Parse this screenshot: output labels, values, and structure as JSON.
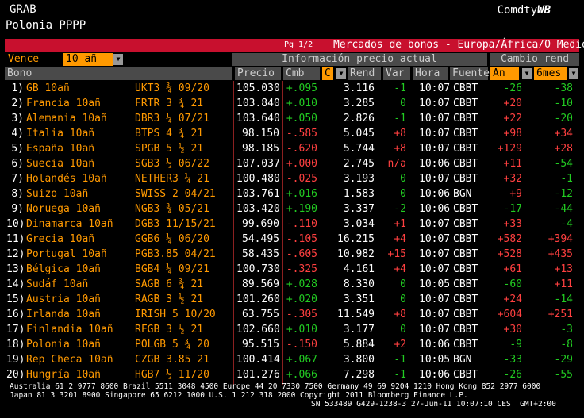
{
  "header": {
    "line1": "GRAB",
    "line2": "Polonia PPPP",
    "brand_text": "Comdty",
    "brand_bold": "WB"
  },
  "titlebar": {
    "page": "Pg 1/2",
    "title": "Mercados de bonos - Europa/África/O Medio"
  },
  "filter": {
    "label": "Vence",
    "value": "10 añ"
  },
  "groups": {
    "info": "Información precio actual",
    "cambio": "Cambio rend"
  },
  "columns": {
    "bono": "Bono",
    "precio": "Precio",
    "cmb": "Cmb",
    "c": "C",
    "rend": "Rend",
    "var": "Var",
    "hora": "Hora",
    "fuente": "Fuente",
    "an": "An",
    "seis": "6mes"
  },
  "rows": [
    {
      "n": "1)",
      "name": "GB 10añ",
      "tk": "UKT3 ¾ 09/20",
      "precio": "105.030",
      "cmb": "+.095",
      "cs": "gr",
      "rend": "3.116",
      "var": "-1",
      "vs": "gr",
      "hora": "10:07",
      "src": "CBBT",
      "an": "-26",
      "as": "gr",
      "m6": "-38",
      "ms": "gr"
    },
    {
      "n": "2)",
      "name": "Francia 10añ",
      "tk": "FRTR 3 ¾ 21",
      "precio": "103.840",
      "cmb": "+.010",
      "cs": "gr",
      "rend": "3.285",
      "var": "0",
      "vs": "gr",
      "hora": "10:07",
      "src": "CBBT",
      "an": "+20",
      "as": "rd",
      "m6": "-10",
      "ms": "gr"
    },
    {
      "n": "3)",
      "name": "Alemania 10añ",
      "tk": "DBR3 ¼ 07/21",
      "precio": "103.640",
      "cmb": "+.050",
      "cs": "gr",
      "rend": "2.826",
      "var": "-1",
      "vs": "gr",
      "hora": "10:07",
      "src": "CBBT",
      "an": "+22",
      "as": "rd",
      "m6": "-20",
      "ms": "gr"
    },
    {
      "n": "4)",
      "name": "Italia 10añ",
      "tk": "BTPS 4 ¾ 21",
      "precio": "98.150",
      "cmb": "-.585",
      "cs": "rd",
      "rend": "5.045",
      "var": "+8",
      "vs": "rd",
      "hora": "10:07",
      "src": "CBBT",
      "an": "+98",
      "as": "rd",
      "m6": "+34",
      "ms": "rd"
    },
    {
      "n": "5)",
      "name": "España 10añ",
      "tk": "SPGB 5 ½ 21",
      "precio": "98.185",
      "cmb": "-.620",
      "cs": "rd",
      "rend": "5.744",
      "var": "+8",
      "vs": "rd",
      "hora": "10:07",
      "src": "CBBT",
      "an": "+129",
      "as": "rd",
      "m6": "+28",
      "ms": "rd"
    },
    {
      "n": "6)",
      "name": "Suecia 10añ",
      "tk": "SGB3 ½ 06/22",
      "precio": "107.037",
      "cmb": "+.000",
      "cs": "rd",
      "rend": "2.745",
      "var": "n/a",
      "vs": "rd",
      "hora": "10:06",
      "src": "CBBT",
      "an": "+11",
      "as": "rd",
      "m6": "-54",
      "ms": "gr"
    },
    {
      "n": "7)",
      "name": "Holandés 10añ",
      "tk": "NETHER3 ¼ 21",
      "precio": "100.480",
      "cmb": "-.025",
      "cs": "rd",
      "rend": "3.193",
      "var": "0",
      "vs": "gr",
      "hora": "10:07",
      "src": "CBBT",
      "an": "+32",
      "as": "rd",
      "m6": "-1",
      "ms": "gr"
    },
    {
      "n": "8)",
      "name": "Suizo 10añ",
      "tk": "SWISS 2 04/21",
      "precio": "103.761",
      "cmb": "+.016",
      "cs": "gr",
      "rend": "1.583",
      "var": "0",
      "vs": "gr",
      "hora": "10:06",
      "src": "BGN",
      "an": "+9",
      "as": "rd",
      "m6": "-12",
      "ms": "gr"
    },
    {
      "n": "9)",
      "name": "Noruega 10añ",
      "tk": "NGB3 ¾ 05/21",
      "precio": "103.420",
      "cmb": "+.190",
      "cs": "gr",
      "rend": "3.337",
      "var": "-2",
      "vs": "gr",
      "hora": "10:06",
      "src": "CBBT",
      "an": "-17",
      "as": "gr",
      "m6": "-44",
      "ms": "gr"
    },
    {
      "n": "10)",
      "name": "Dinamarca 10añ",
      "tk": "DGB3 11/15/21",
      "precio": "99.690",
      "cmb": "-.110",
      "cs": "rd",
      "rend": "3.034",
      "var": "+1",
      "vs": "rd",
      "hora": "10:07",
      "src": "CBBT",
      "an": "+33",
      "as": "rd",
      "m6": "-4",
      "ms": "gr"
    },
    {
      "n": "11)",
      "name": "Grecia 10añ",
      "tk": "GGB6 ¼ 06/20",
      "precio": "54.495",
      "cmb": "-.105",
      "cs": "rd",
      "rend": "16.215",
      "var": "+4",
      "vs": "rd",
      "hora": "10:07",
      "src": "CBBT",
      "an": "+582",
      "as": "rd",
      "m6": "+394",
      "ms": "rd"
    },
    {
      "n": "12)",
      "name": "Portugal 10añ",
      "tk": "PGB3.85 04/21",
      "precio": "58.435",
      "cmb": "-.605",
      "cs": "rd",
      "rend": "10.982",
      "var": "+15",
      "vs": "rd",
      "hora": "10:07",
      "src": "CBBT",
      "an": "+528",
      "as": "rd",
      "m6": "+435",
      "ms": "rd"
    },
    {
      "n": "13)",
      "name": "Bélgica 10añ",
      "tk": "BGB4 ¼ 09/21",
      "precio": "100.730",
      "cmb": "-.325",
      "cs": "rd",
      "rend": "4.161",
      "var": "+4",
      "vs": "rd",
      "hora": "10:07",
      "src": "CBBT",
      "an": "+61",
      "as": "rd",
      "m6": "+13",
      "ms": "rd"
    },
    {
      "n": "14)",
      "name": "Sudáf 10añ",
      "tk": "SAGB 6 ¾ 21",
      "precio": "89.569",
      "cmb": "+.028",
      "cs": "gr",
      "rend": "8.330",
      "var": "0",
      "vs": "gr",
      "hora": "10:05",
      "src": "CBBT",
      "an": "-60",
      "as": "gr",
      "m6": "+11",
      "ms": "rd"
    },
    {
      "n": "15)",
      "name": "Austria 10añ",
      "tk": "RAGB 3 ½ 21",
      "precio": "101.260",
      "cmb": "+.020",
      "cs": "gr",
      "rend": "3.351",
      "var": "0",
      "vs": "gr",
      "hora": "10:07",
      "src": "CBBT",
      "an": "+24",
      "as": "rd",
      "m6": "-14",
      "ms": "gr"
    },
    {
      "n": "16)",
      "name": "Irlanda 10añ",
      "tk": "IRISH 5 10/20",
      "precio": "63.755",
      "cmb": "-.305",
      "cs": "rd",
      "rend": "11.549",
      "var": "+8",
      "vs": "rd",
      "hora": "10:07",
      "src": "CBBT",
      "an": "+604",
      "as": "rd",
      "m6": "+251",
      "ms": "rd"
    },
    {
      "n": "17)",
      "name": "Finlandia 10añ",
      "tk": "RFGB 3 ½ 21",
      "precio": "102.660",
      "cmb": "+.010",
      "cs": "gr",
      "rend": "3.177",
      "var": "0",
      "vs": "gr",
      "hora": "10:07",
      "src": "CBBT",
      "an": "+30",
      "as": "rd",
      "m6": "-3",
      "ms": "gr"
    },
    {
      "n": "18)",
      "name": "Polonia 10añ",
      "tk": "POLGB 5 ¾ 20",
      "precio": "95.515",
      "cmb": "-.150",
      "cs": "rd",
      "rend": "5.884",
      "var": "+2",
      "vs": "rd",
      "hora": "10:06",
      "src": "CBBT",
      "an": "-9",
      "as": "gr",
      "m6": "-8",
      "ms": "gr"
    },
    {
      "n": "19)",
      "name": "Rep Checa 10añ",
      "tk": "CZGB 3.85 21",
      "precio": "100.414",
      "cmb": "+.067",
      "cs": "gr",
      "rend": "3.800",
      "var": "-1",
      "vs": "gr",
      "hora": "10:05",
      "src": "BGN",
      "an": "-33",
      "as": "gr",
      "m6": "-29",
      "ms": "gr"
    },
    {
      "n": "20)",
      "name": "Hungría 10añ",
      "tk": "HGB7 ½ 11/20",
      "precio": "101.276",
      "cmb": "+.066",
      "cs": "gr",
      "rend": "7.298",
      "var": "-1",
      "vs": "gr",
      "hora": "10:06",
      "src": "CBBT",
      "an": "-26",
      "as": "gr",
      "m6": "-55",
      "ms": "gr"
    }
  ],
  "footer": {
    "l1": "Australia 61 2 9777 8600 Brazil 5511 3048 4500 Europe 44 20 7330 7500 Germany 49 69 9204 1210 Hong Kong 852 2977 6000",
    "l2": "Japan 81 3 3201 8900       Singapore 65 6212 1000       U.S. 1 212 318 2000       Copyright 2011 Bloomberg Finance L.P.",
    "l3": "SN 533489 G429-1238-3 27-Jun-11 10:07:10 CEST GMT+2:00"
  }
}
